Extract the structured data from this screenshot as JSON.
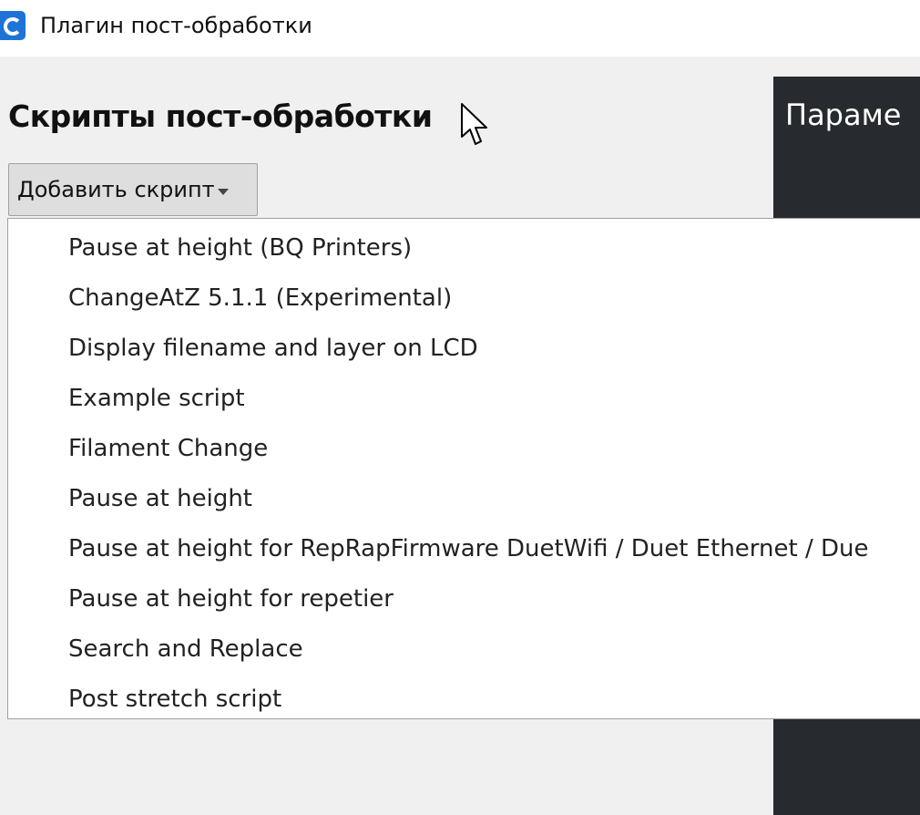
{
  "window": {
    "title": "Плагин пост-обработки",
    "icon": "cura-app-icon"
  },
  "panel": {
    "title": "Скрипты пост-обработки"
  },
  "add_script": {
    "label": "Добавить скрипт",
    "icon": "chevron-down-icon"
  },
  "right_panel": {
    "title": "Параме"
  },
  "menu": {
    "items": [
      {
        "label": "Pause at height (BQ Printers)"
      },
      {
        "label": "ChangeAtZ 5.1.1 (Experimental)"
      },
      {
        "label": "Display filename and layer on LCD"
      },
      {
        "label": "Example script"
      },
      {
        "label": "Filament Change"
      },
      {
        "label": "Pause at height"
      },
      {
        "label": "Pause at height for RepRapFirmware DuetWifi / Duet Ethernet / Due"
      },
      {
        "label": "Pause at height for repetier"
      },
      {
        "label": "Search and Replace"
      },
      {
        "label": "Post stretch script"
      }
    ]
  },
  "colors": {
    "accent": "#1e74d6",
    "dark_panel": "#272a2f",
    "window_background": "#f0f0f0"
  }
}
